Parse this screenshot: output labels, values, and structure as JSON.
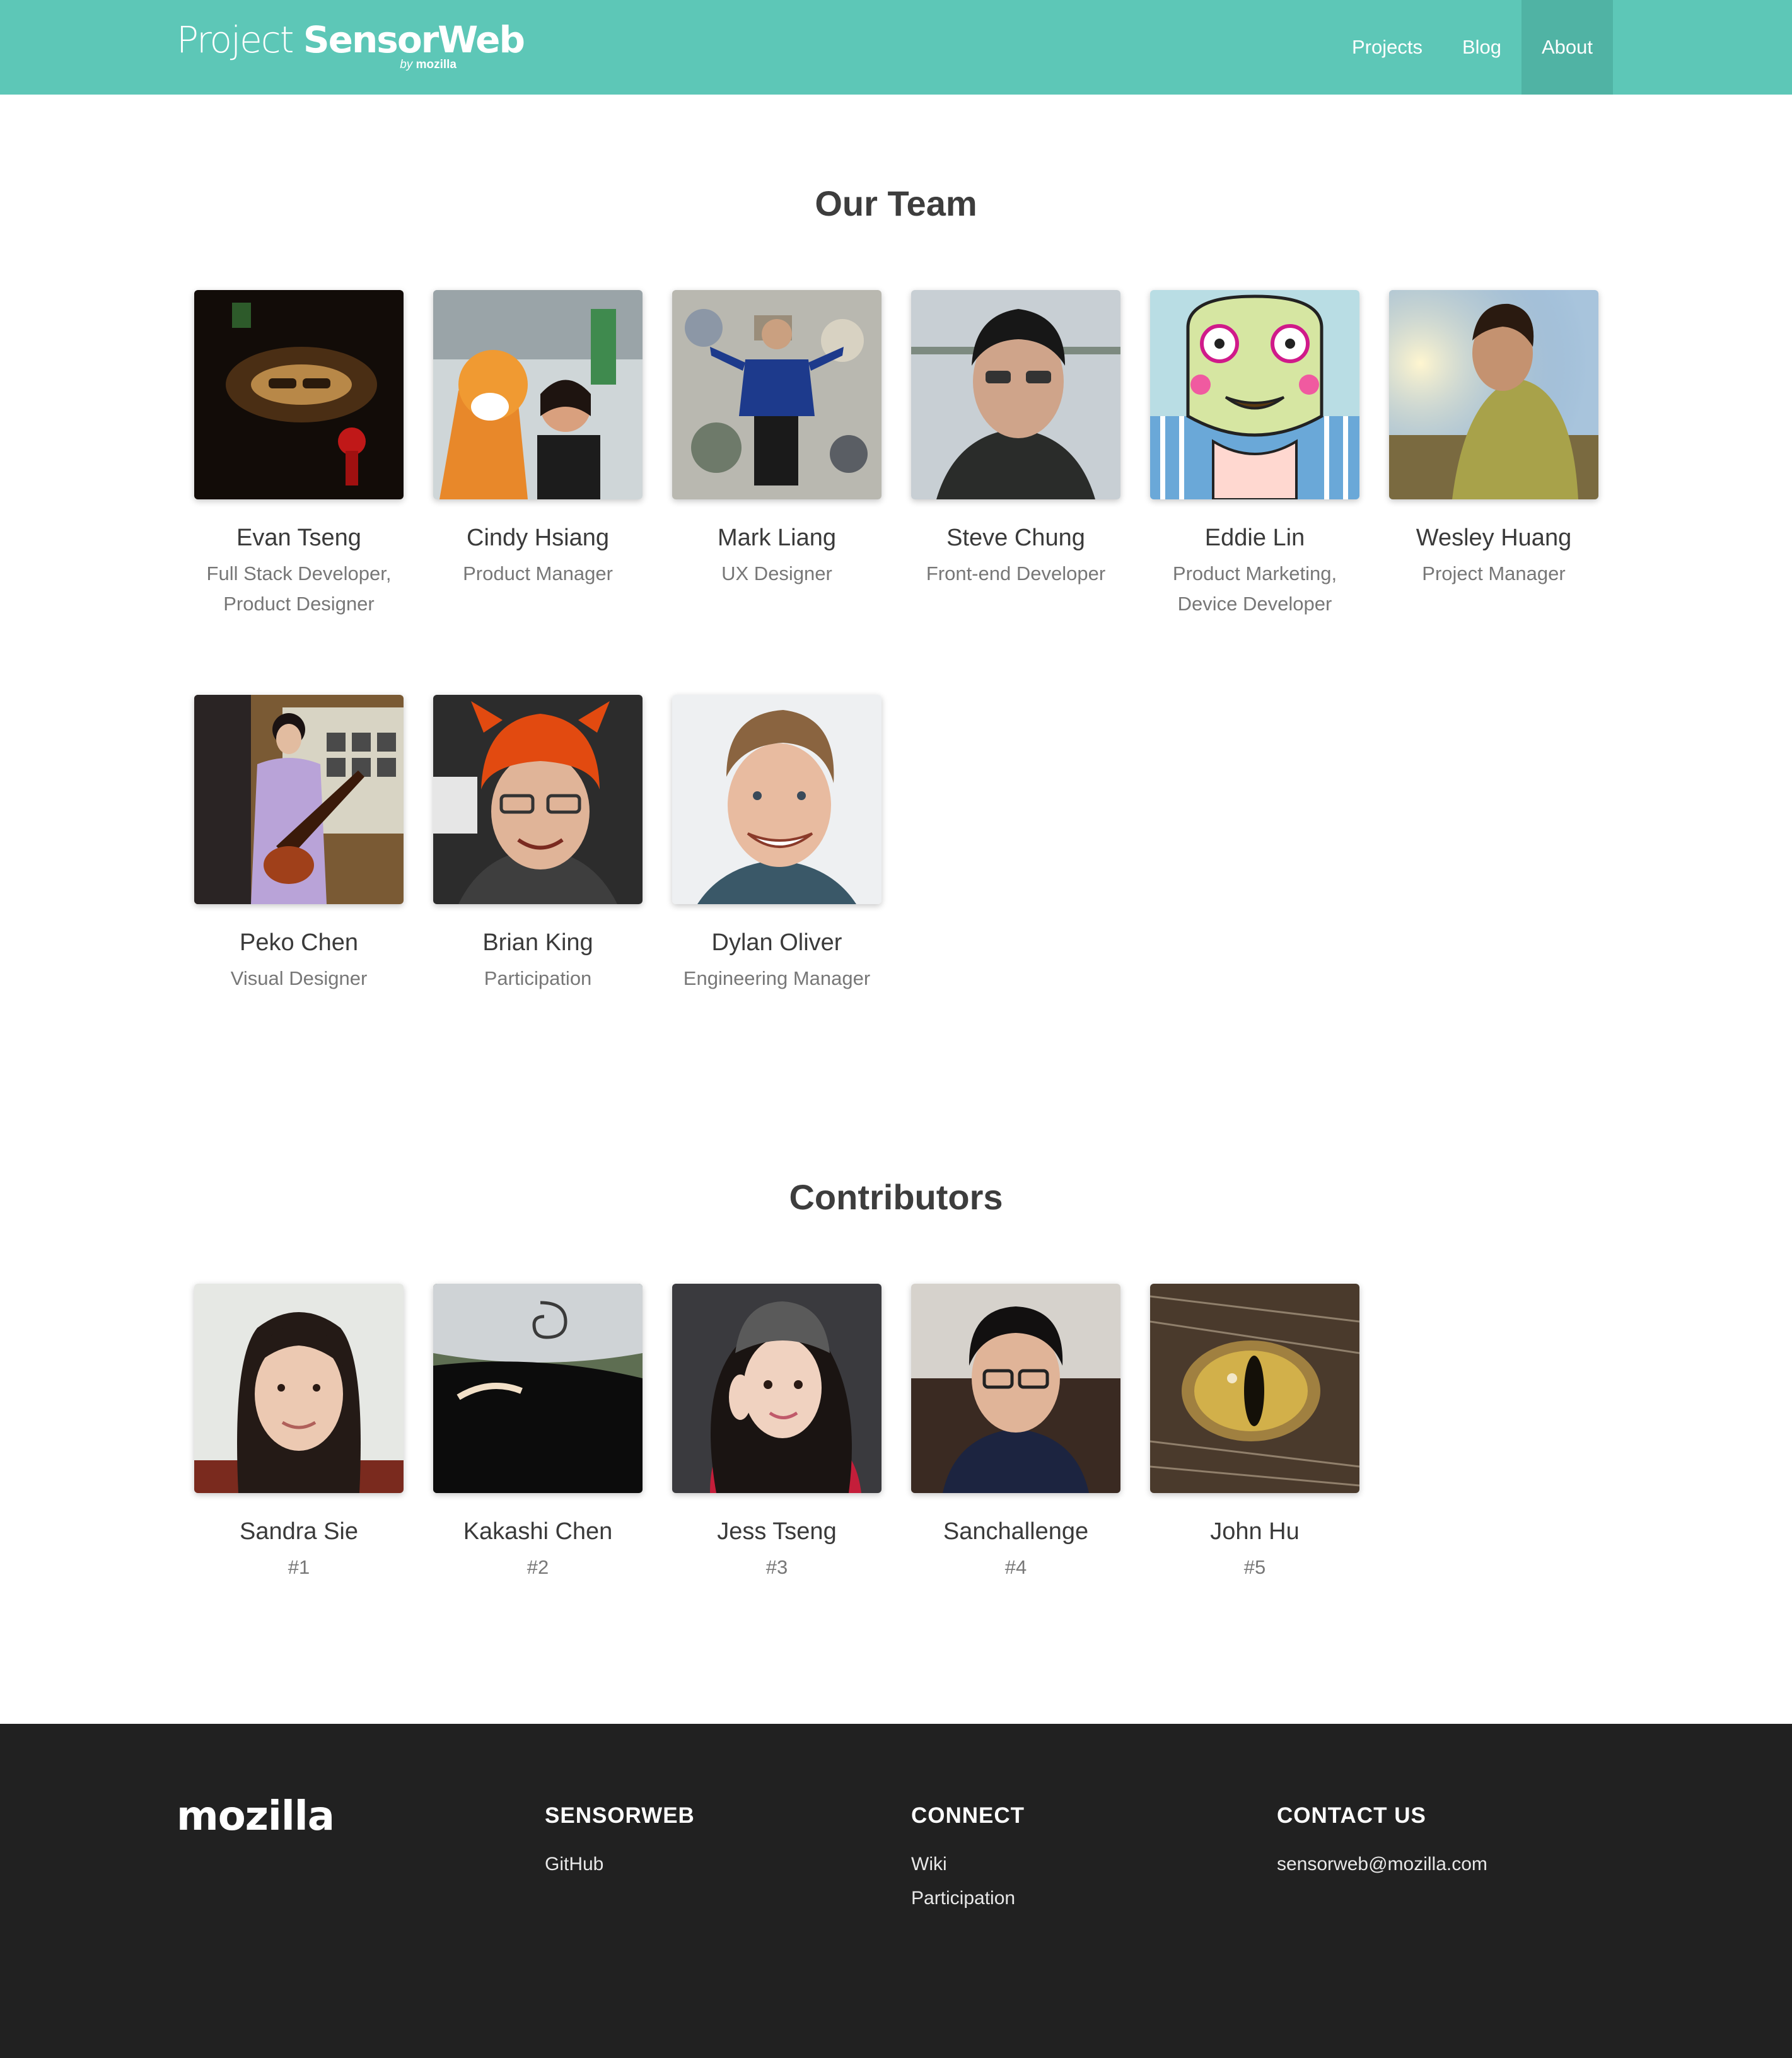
{
  "header": {
    "logo_text_light": "Project ",
    "logo_text_bold": "SensorWeb",
    "logo_sub_by": "by",
    "logo_sub_brand": "mozilla",
    "nav": [
      "Projects",
      "Blog",
      "About"
    ],
    "active_nav": "About",
    "accent_color": "#5dc7b7"
  },
  "team": {
    "title": "Our Team",
    "members": [
      {
        "name": "Evan Tseng",
        "role_line1": "Full Stack Developer,",
        "role_line2": "Product Designer"
      },
      {
        "name": "Cindy Hsiang",
        "role_line1": "Product Manager",
        "role_line2": ""
      },
      {
        "name": "Mark Liang",
        "role_line1": "UX Designer",
        "role_line2": ""
      },
      {
        "name": "Steve Chung",
        "role_line1": "Front-end Developer",
        "role_line2": ""
      },
      {
        "name": "Eddie Lin",
        "role_line1": "Product Marketing,",
        "role_line2": "Device Developer"
      },
      {
        "name": "Wesley Huang",
        "role_line1": "Project Manager",
        "role_line2": ""
      },
      {
        "name": "Peko Chen",
        "role_line1": "Visual Designer",
        "role_line2": ""
      },
      {
        "name": "Brian King",
        "role_line1": "Participation",
        "role_line2": ""
      },
      {
        "name": "Dylan Oliver",
        "role_line1": "Engineering Manager",
        "role_line2": ""
      }
    ]
  },
  "contributors": {
    "title": "Contributors",
    "members": [
      {
        "name": "Sandra Sie",
        "rank": "#1"
      },
      {
        "name": "Kakashi Chen",
        "rank": "#2"
      },
      {
        "name": "Jess Tseng",
        "rank": "#3"
      },
      {
        "name": "Sanchallenge",
        "rank": "#4"
      },
      {
        "name": "John Hu",
        "rank": "#5"
      }
    ]
  },
  "footer": {
    "logo": "mozilla",
    "columns": [
      {
        "heading": "SENSORWEB",
        "links": [
          "GitHub"
        ]
      },
      {
        "heading": "CONNECT",
        "links": [
          "Wiki",
          "Participation"
        ]
      },
      {
        "heading": "CONTACT US",
        "links": [
          "sensorweb@mozilla.com"
        ]
      }
    ]
  }
}
